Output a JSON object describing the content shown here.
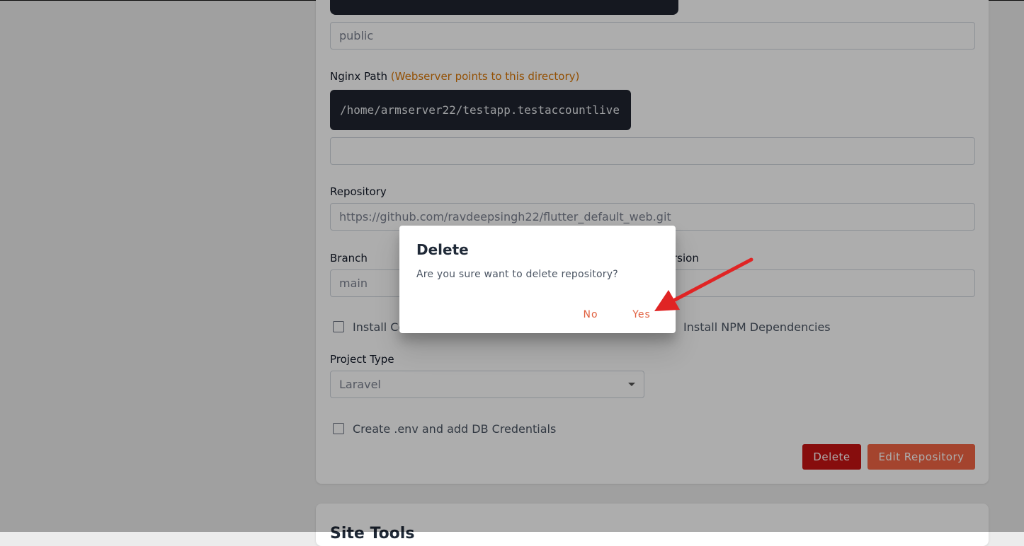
{
  "form": {
    "public_dir_value": "public",
    "nginx_label": "Nginx Path",
    "nginx_hint": "(Webserver points to this directory)",
    "nginx_path": "/home/armserver22/testapp.testaccountlive",
    "nginx_input_value": "",
    "repo_label": "Repository",
    "repo_value": "https://github.com/ravdeepsingh22/flutter_default_web.git",
    "branch_label": "Branch",
    "branch_value": "main",
    "version_label_partial": "rsion",
    "install_composer_label": "Install Co",
    "install_npm_label": "Install NPM Dependencies",
    "project_type_label": "Project Type",
    "project_type_value": "Laravel",
    "create_env_label": "Create .env and add DB Credentials",
    "delete_button": "Delete",
    "edit_button": "Edit Repository"
  },
  "next_card": {
    "title": "Site Tools"
  },
  "dialog": {
    "title": "Delete",
    "message": "Are you sure want to delete repository?",
    "no_label": "No",
    "yes_label": "Yes"
  },
  "colors": {
    "accent": "#f26545",
    "danger": "#c81414",
    "hint": "#d97706",
    "annotation_arrow": "#e02424"
  }
}
